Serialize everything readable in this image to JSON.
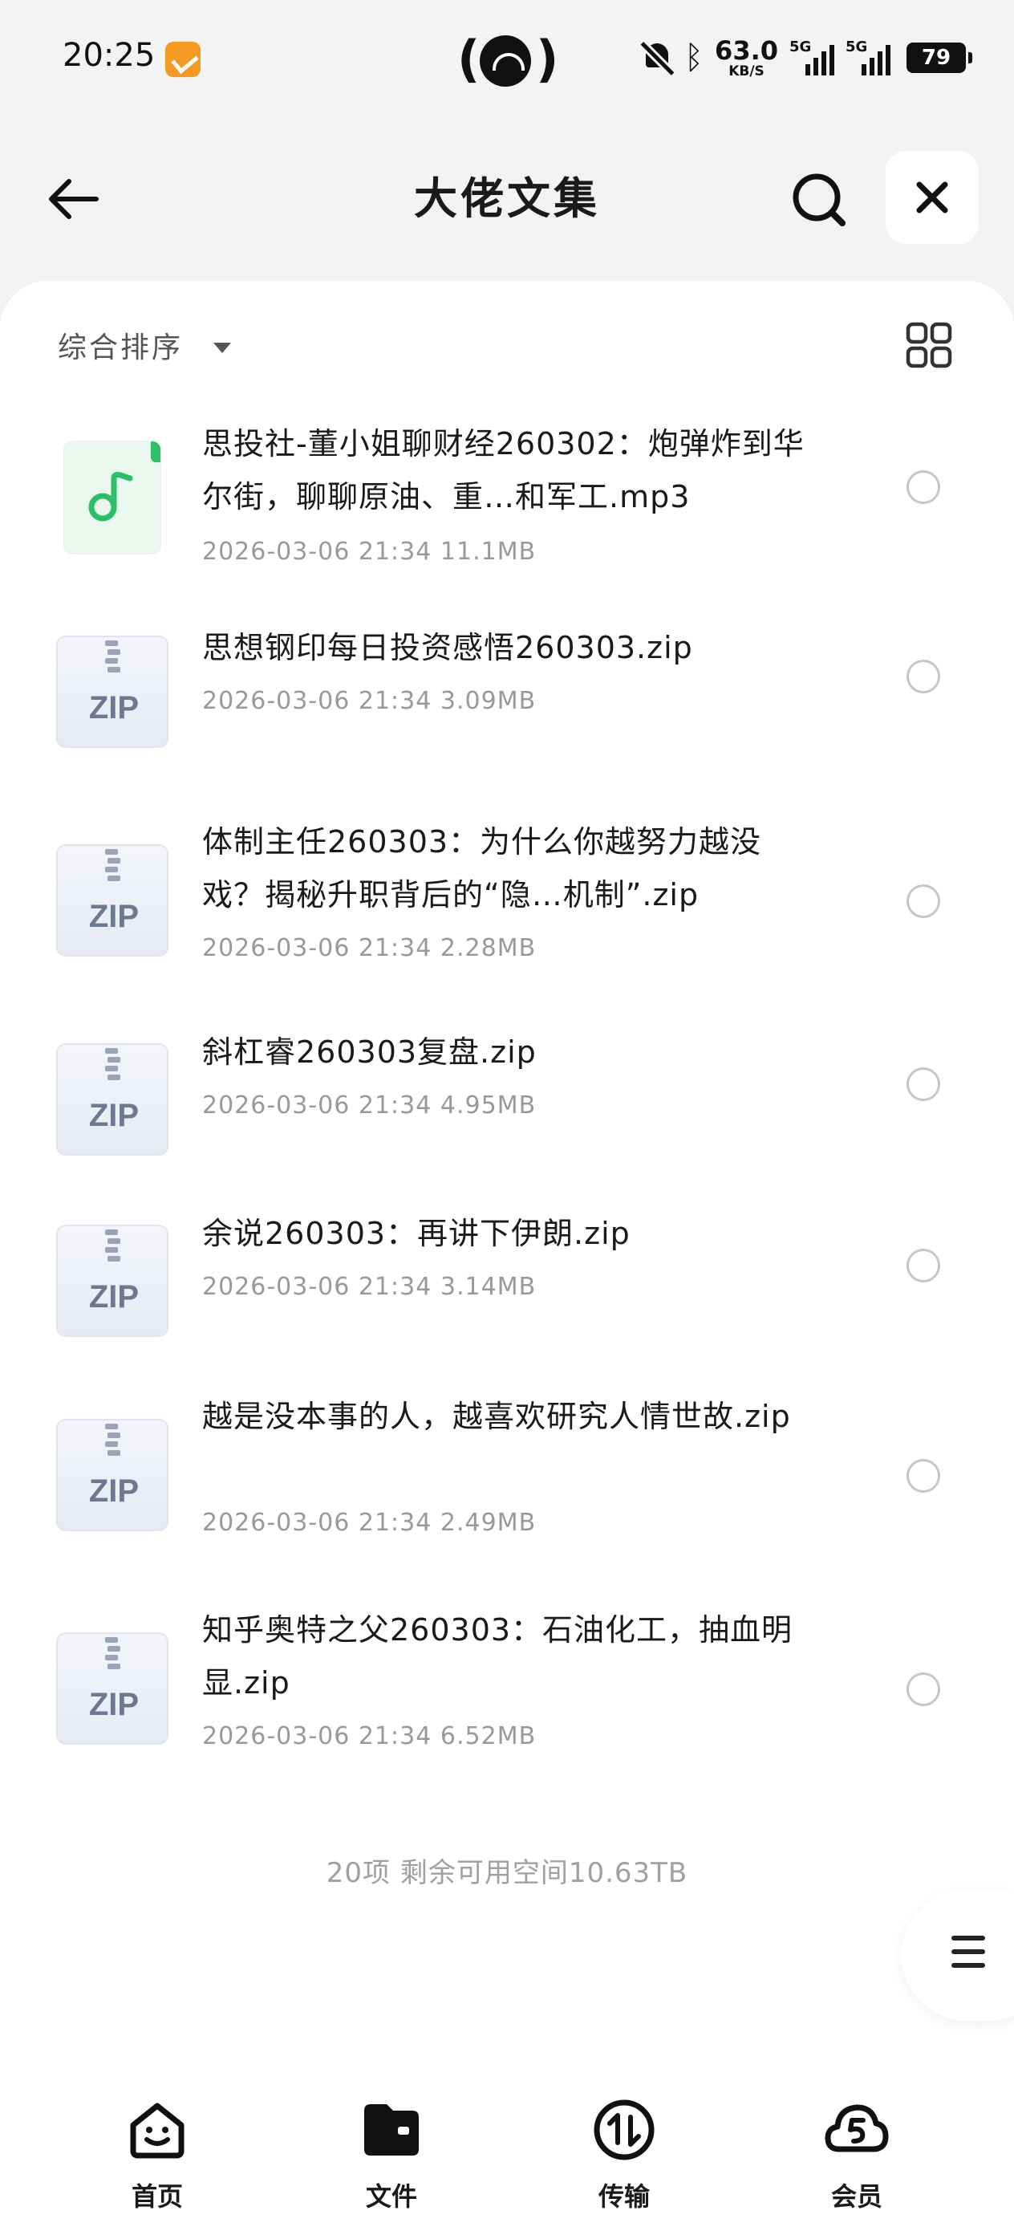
{
  "status_bar": {
    "time": "20:25",
    "net_speed_value": "63.0",
    "net_speed_unit": "KB/S",
    "signal1_label": "5G",
    "signal2_label": "5G",
    "battery_level": "79",
    "icons": [
      "app-notification-icon",
      "hotspot-icon",
      "bell-off-icon",
      "bluetooth-icon",
      "signal-icon",
      "battery-icon"
    ]
  },
  "header": {
    "title": "大佬文集",
    "icons": [
      "back-arrow-icon",
      "search-icon",
      "close-icon"
    ]
  },
  "toolbar": {
    "sort_label": "综合排序",
    "icons": [
      "caret-down-icon",
      "grid-view-icon"
    ]
  },
  "files": [
    {
      "name": "思投社-董小姐聊财经260302：炮弹炸到华尔街，聊聊原油、重…和军工.mp3",
      "date": "2026-03-06 21:34",
      "size": "11.1MB",
      "type": "audio"
    },
    {
      "name": "思想钢印每日投资感悟260303.zip",
      "date": "2026-03-06 21:34",
      "size": "3.09MB",
      "type": "zip"
    },
    {
      "name": "体制主任260303：为什么你越努力越没戏？揭秘升职背后的“隐…机制”.zip",
      "date": "2026-03-06 21:34",
      "size": "2.28MB",
      "type": "zip"
    },
    {
      "name": "斜杠睿260303复盘.zip",
      "date": "2026-03-06 21:34",
      "size": "4.95MB",
      "type": "zip"
    },
    {
      "name": "余说260303：再讲下伊朗.zip",
      "date": "2026-03-06 21:34",
      "size": "3.14MB",
      "type": "zip"
    },
    {
      "name": "越是没本事的人，越喜欢研究人情世故.zip",
      "date": "2026-03-06 21:34",
      "size": "2.49MB",
      "type": "zip"
    },
    {
      "name": "知乎奥特之父260303：石油化工，抽血明显.zip",
      "date": "2026-03-06 21:34",
      "size": "6.52MB",
      "type": "zip"
    }
  ],
  "zip_icon_label": "ZIP",
  "summary": "20项 剩余可用空间10.63TB",
  "nav": {
    "items": [
      {
        "label": "首页",
        "icon": "home-smile-icon"
      },
      {
        "label": "文件",
        "icon": "folder-icon"
      },
      {
        "label": "传输",
        "icon": "transfer-icon"
      },
      {
        "label": "会员",
        "icon": "vip-cloud-icon"
      }
    ]
  },
  "colors": {
    "background": "#f2f3f5",
    "card": "#ffffff",
    "meta_text": "#999999",
    "music_green": "#2bbf68"
  }
}
